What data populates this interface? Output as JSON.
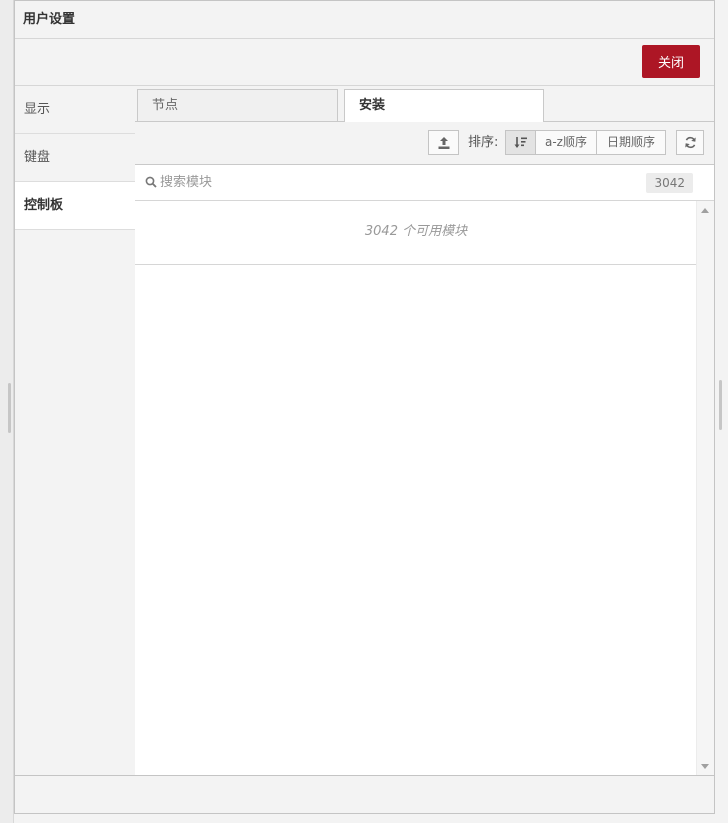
{
  "dialog": {
    "title": "用户设置",
    "close_label": "关闭"
  },
  "sidebar": {
    "items": [
      {
        "label": "显示"
      },
      {
        "label": "键盘"
      },
      {
        "label": "控制板"
      }
    ],
    "active_index": 2
  },
  "tabs": [
    {
      "label": "节点"
    },
    {
      "label": "安装"
    }
  ],
  "active_tab": 1,
  "toolbar": {
    "upload_icon": "upload-icon",
    "sort_label": "排序:",
    "sort_options": [
      {
        "icon": "sort-relevance-icon",
        "selected": true
      },
      {
        "label": "a-z顺序",
        "selected": false
      },
      {
        "label": "日期顺序",
        "selected": false
      }
    ],
    "refresh_icon": "refresh-icon"
  },
  "search": {
    "placeholder": "搜索模块",
    "value": "",
    "count": "3042"
  },
  "results": {
    "summary": "3042 个可用模块"
  },
  "colors": {
    "accent": "#ad1625",
    "background": "#f3f3f3",
    "panel": "#ffffff",
    "border": "#c9c9c9"
  }
}
